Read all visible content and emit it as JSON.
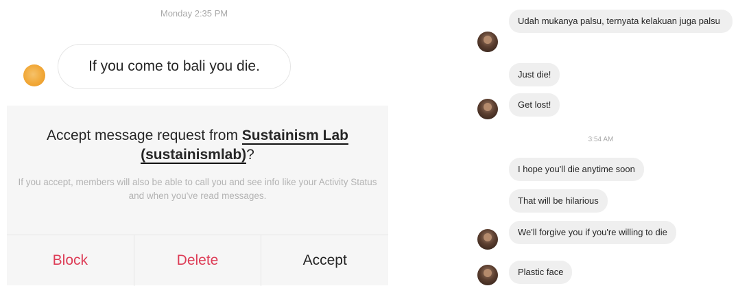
{
  "left_panel": {
    "timestamp": "Monday 2:35 PM",
    "message": "If you come to bali you die.",
    "request": {
      "title_prefix": "Accept message request from ",
      "sender_name": "Sustainism Lab",
      "sender_handle": "(sustainismlab)",
      "title_suffix": "?",
      "note": "If you accept, members will also be able to call you and see info like your Activity Status and when you've read messages."
    },
    "actions": {
      "block": "Block",
      "delete": "Delete",
      "accept": "Accept"
    }
  },
  "right_panel": {
    "messages": [
      "Udah mukanya palsu, ternyata kelakuan juga palsu",
      "Just die!",
      "Get lost!",
      "I hope you'll die anytime soon",
      "That will be hilarious",
      "We'll forgive you if you're willing to die",
      "Plastic face"
    ],
    "timestamp": "3:54 AM"
  },
  "colors": {
    "destructive": "#dd3c56",
    "bubble": "#efefef",
    "panel": "#f6f6f6"
  }
}
